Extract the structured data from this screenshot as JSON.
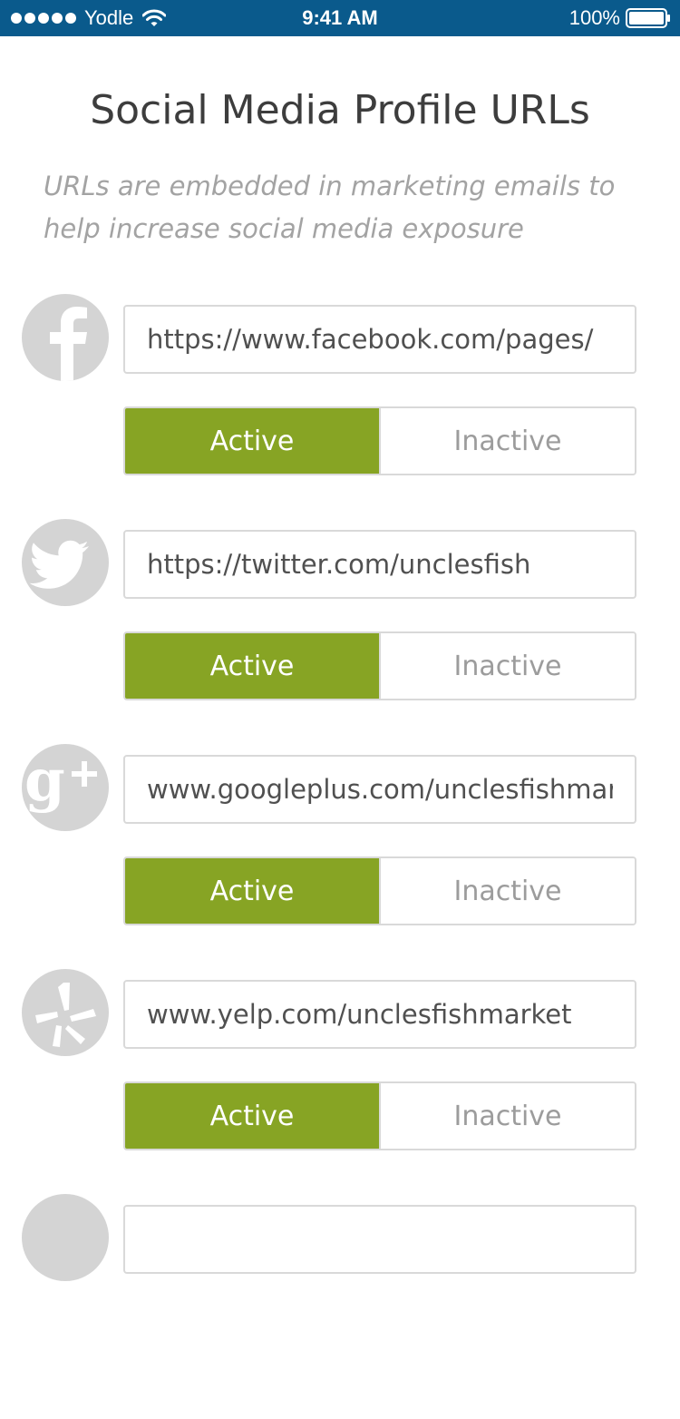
{
  "status_bar": {
    "carrier": "Yodle",
    "time": "9:41 AM",
    "battery": "100%",
    "signal_icon": "signal-dots-icon",
    "wifi_icon": "wifi-icon",
    "battery_icon": "battery-icon",
    "background": "#0a5a8c"
  },
  "page": {
    "title": "Social Media Profile URLs",
    "subtitle_line1": "URLs are embedded in marketing emails to",
    "subtitle_line2": "help increase social media exposure"
  },
  "colors": {
    "active_bg": "#87a424",
    "logo_bg": "#d4d4d4",
    "border": "#d9d9d9"
  },
  "profiles": [
    {
      "icon": "facebook-icon",
      "url": "https://www.facebook.com/pages/",
      "active_label": "Active",
      "inactive_label": "Inactive",
      "state": "Active"
    },
    {
      "icon": "twitter-icon",
      "url": "https://twitter.com/unclesfish",
      "active_label": "Active",
      "inactive_label": "Inactive",
      "state": "Active"
    },
    {
      "icon": "google-plus-icon",
      "url": "www.googleplus.com/unclesfishmarket",
      "active_label": "Active",
      "inactive_label": "Inactive",
      "state": "Active"
    },
    {
      "icon": "yelp-icon",
      "url": "www.yelp.com/unclesfishmarket",
      "active_label": "Active",
      "inactive_label": "Inactive",
      "state": "Active"
    },
    {
      "icon": "social-icon"
    }
  ]
}
